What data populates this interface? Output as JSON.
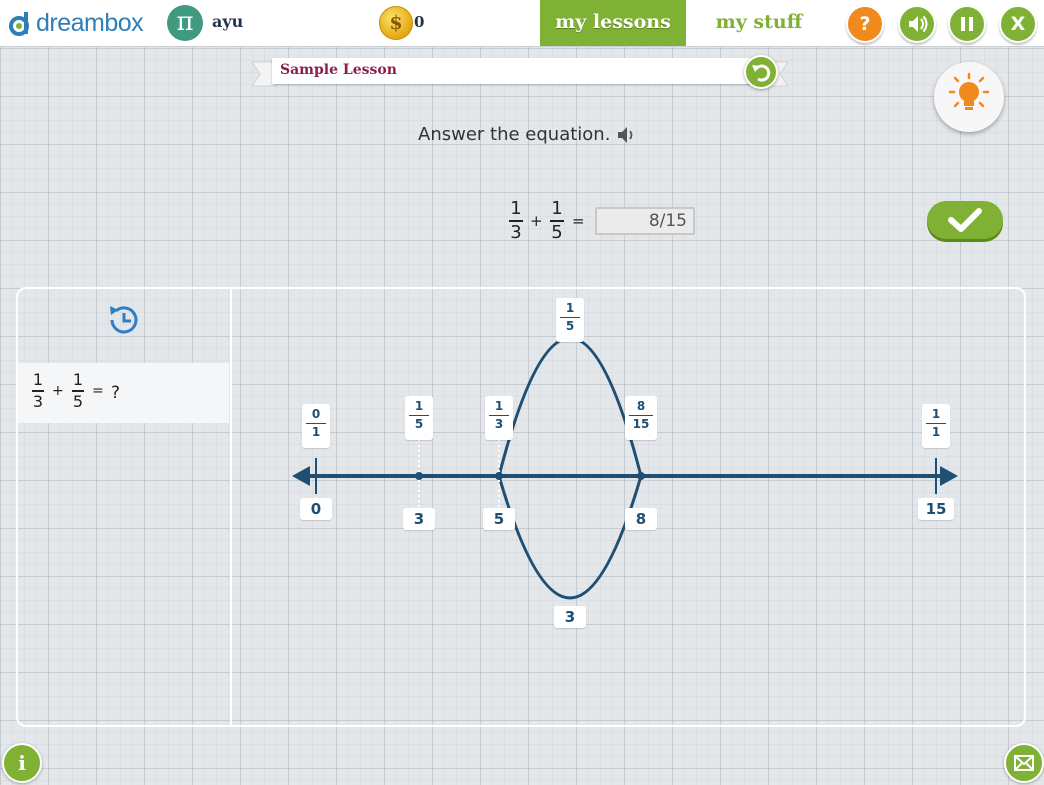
{
  "header": {
    "logo_text": "dreambox",
    "avatar_glyph": "π",
    "username": "ayu",
    "coin_glyph": "$",
    "coins": "0",
    "tab_lessons": "my lessons",
    "tab_stuff": "my stuff",
    "help_glyph": "?",
    "exit_glyph": "X"
  },
  "lesson": {
    "title": "Sample Lesson",
    "prompt": "Answer the equation."
  },
  "equation": {
    "a_num": "1",
    "a_den": "3",
    "plus": "+",
    "b_num": "1",
    "b_den": "5",
    "equals": "=",
    "answer": "8/15"
  },
  "history": {
    "a_num": "1",
    "a_den": "3",
    "plus": "+",
    "b_num": "1",
    "b_den": "5",
    "equals": "=",
    "result": "?"
  },
  "number_line": {
    "fraction_labels": [
      {
        "num": "0",
        "den": "1"
      },
      {
        "num": "1",
        "den": "5"
      },
      {
        "num": "1",
        "den": "3"
      },
      {
        "num": "1",
        "den": "5"
      },
      {
        "num": "8",
        "den": "15"
      },
      {
        "num": "1",
        "den": "1"
      }
    ],
    "count_labels": [
      "0",
      "3",
      "5",
      "3",
      "8",
      "15"
    ]
  },
  "footer": {
    "info_glyph": "i"
  },
  "colors": {
    "accent_green": "#7fb234",
    "help_orange": "#f08a1c",
    "line_navy": "#1f4f73",
    "lesson_title": "#8a1e4c"
  }
}
